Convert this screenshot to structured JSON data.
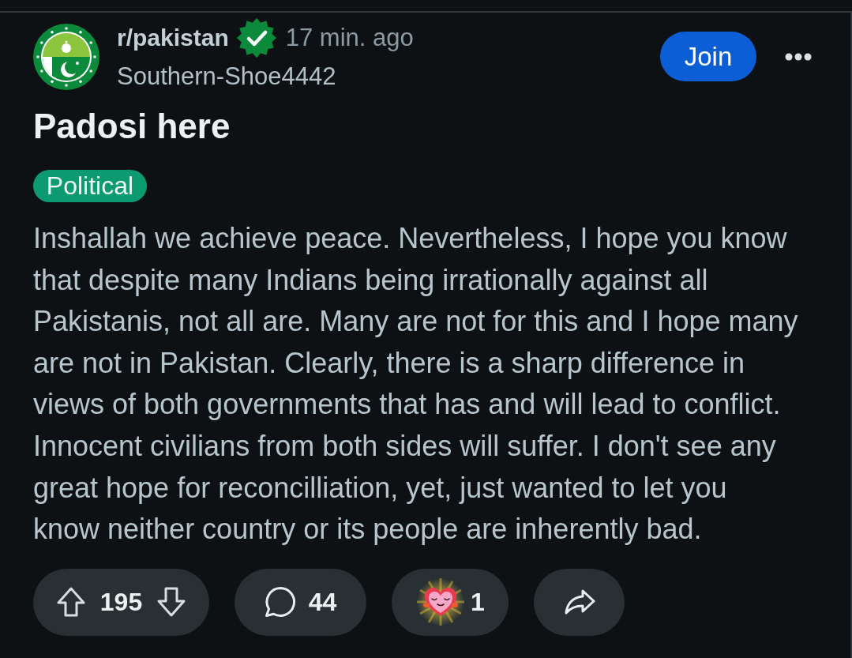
{
  "post": {
    "subreddit": "r/pakistan",
    "verified": true,
    "time": "17 min. ago",
    "author": "Southern-Shoe4442",
    "join_button": "Join",
    "title": "Padosi here",
    "flair": "Political",
    "body": "Inshallah we achieve peace. Nevertheless, I hope you know that despite many Indians being irrationally against all Pakistanis, not all are. Many are not for this and I hope many are not in Pakistan. Clearly, there is a sharp difference in views of both governments that has and will lead to conflict. Innocent civilians from both sides will suffer. I don't see any great hope for reconcilliation, yet, just wanted to let you know neither country or its people are inherently bad.",
    "actions": {
      "score": "195",
      "comments": "44",
      "awards": "1"
    }
  }
}
